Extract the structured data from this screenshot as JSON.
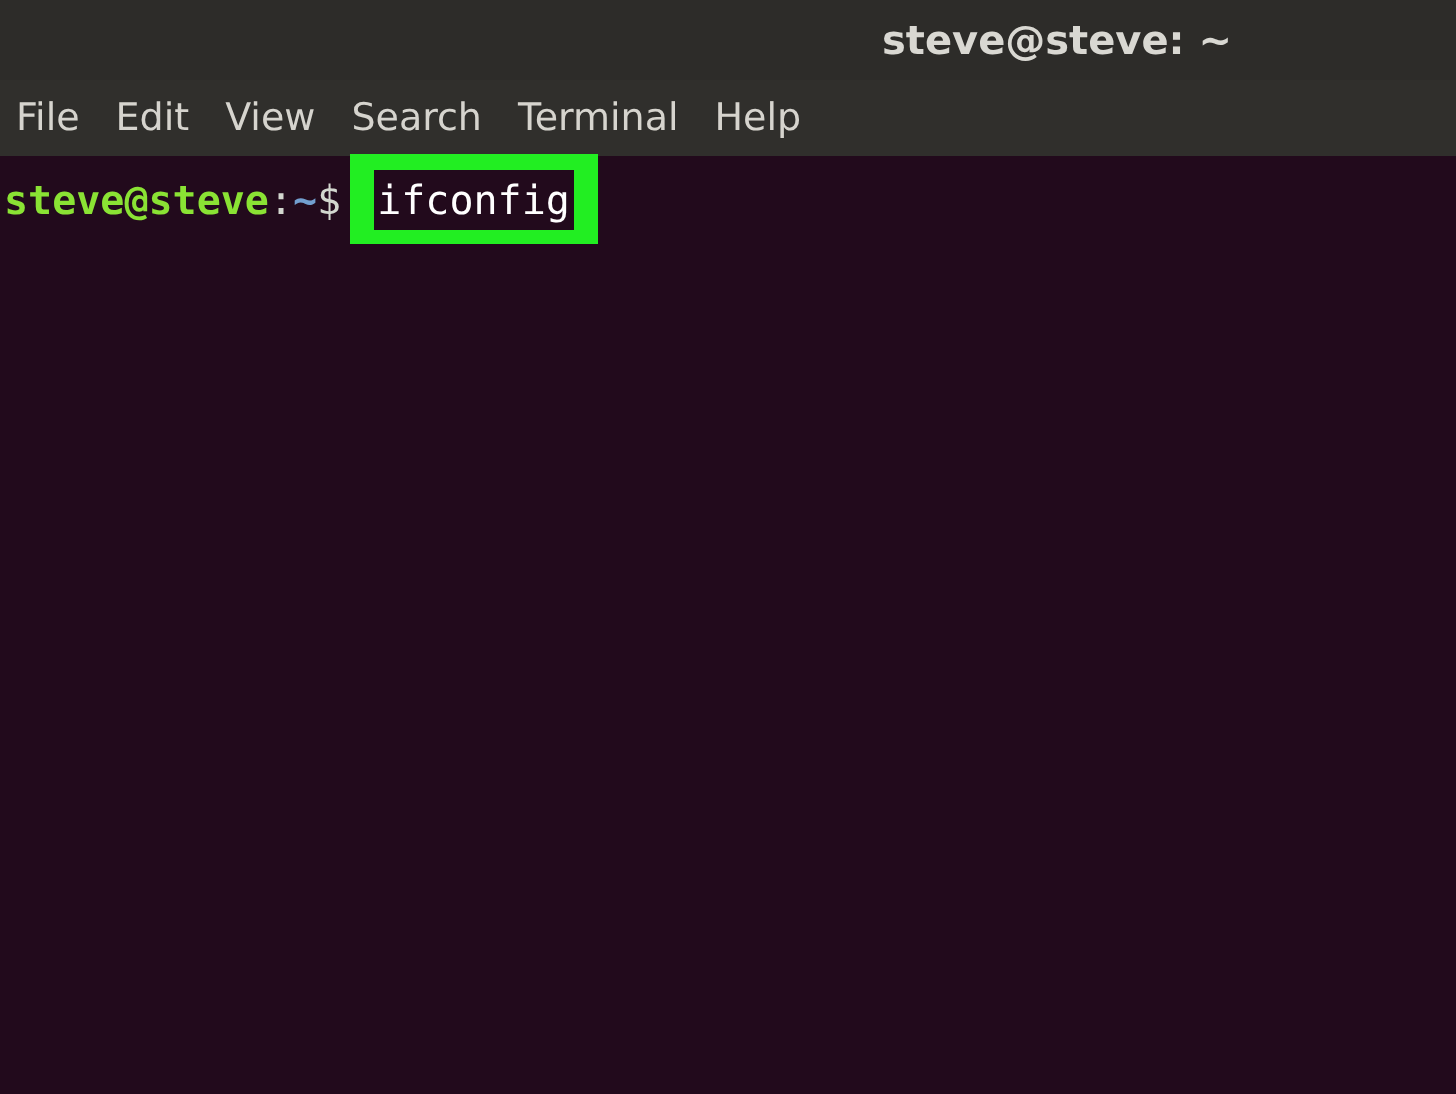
{
  "window": {
    "title": "steve@steve: ~"
  },
  "menu": [
    "File",
    "Edit",
    "View",
    "Search",
    "Terminal",
    "Help"
  ],
  "prompt": {
    "user_host": "steve@steve",
    "separator": ":",
    "path": "~",
    "symbol": "$",
    "command": "ifconfig"
  }
}
